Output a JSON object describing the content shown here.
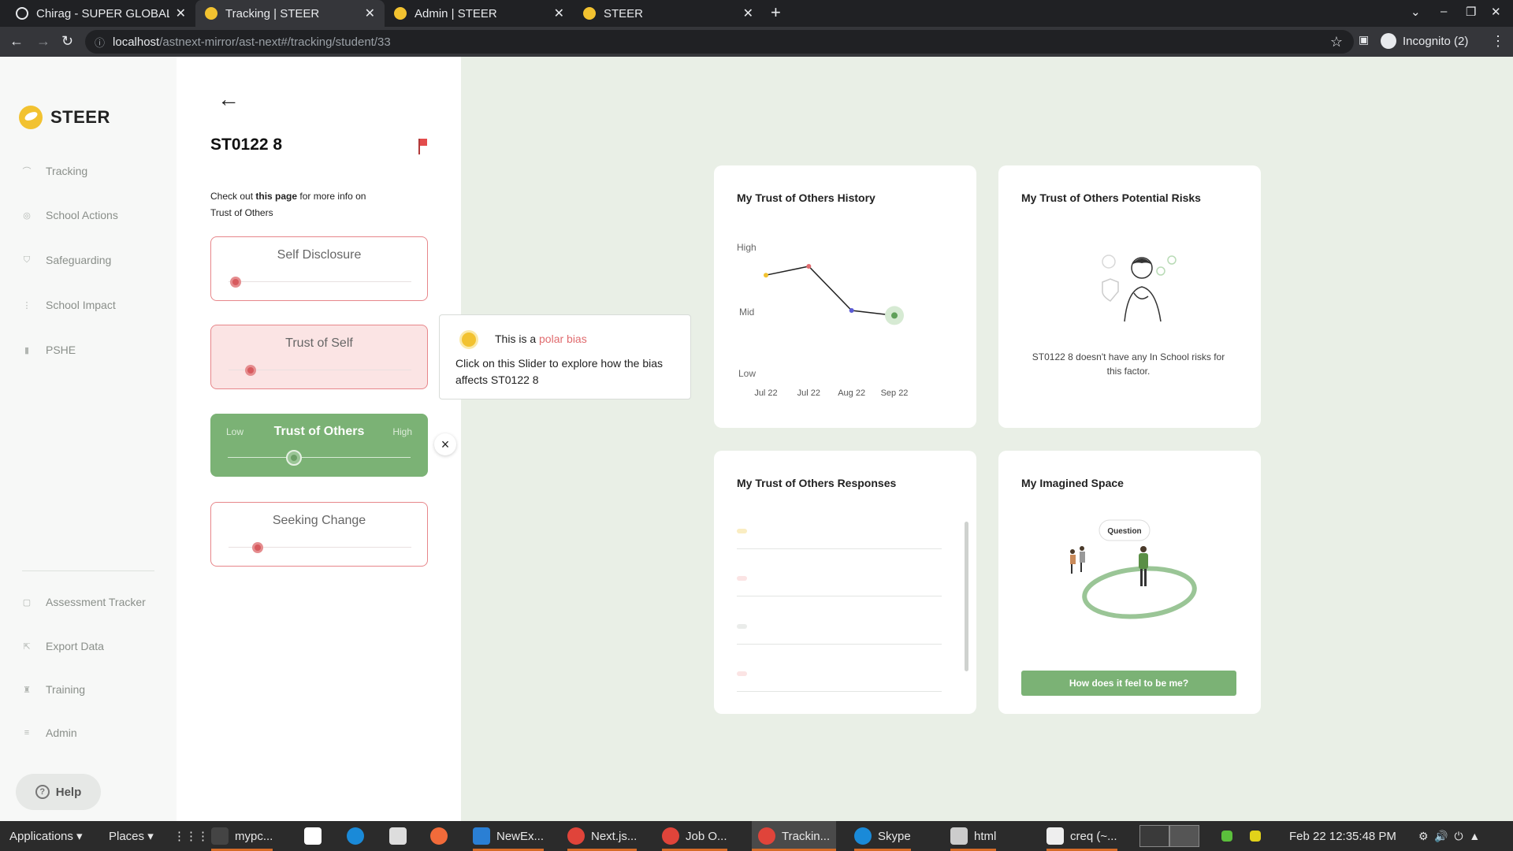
{
  "browser": {
    "tabs": [
      {
        "title": "Chirag - SUPER GLOBAL A",
        "active": false
      },
      {
        "title": "Tracking | STEER",
        "active": true
      },
      {
        "title": "Admin | STEER",
        "active": false
      },
      {
        "title": "STEER",
        "active": false
      }
    ],
    "new_tab": "+",
    "url_host": "localhost",
    "url_path": "/astnext-mirror/ast-next#/tracking/student/33",
    "profile": "Incognito (2)"
  },
  "sidebar": {
    "logo_text": "STEER",
    "items": [
      {
        "label": "Tracking",
        "icon": "line-icon"
      },
      {
        "label": "School Actions",
        "icon": "target-icon"
      },
      {
        "label": "Safeguarding",
        "icon": "shield-icon"
      },
      {
        "label": "School Impact",
        "icon": "bars-icon"
      },
      {
        "label": "PSHE",
        "icon": "book-icon"
      }
    ],
    "bottom_items": [
      {
        "label": "Assessment Tracker",
        "icon": "clipboard-icon"
      },
      {
        "label": "Export Data",
        "icon": "export-icon"
      },
      {
        "label": "Training",
        "icon": "trophy-icon"
      },
      {
        "label": "Admin",
        "icon": "menu-icon"
      }
    ],
    "help_label": "Help"
  },
  "panel": {
    "back_arrow": "←",
    "student_id": "ST0122 8",
    "info_prefix": "Check out ",
    "info_link": "this page",
    "info_suffix": " for more info on",
    "info_topic": "Trust of Others",
    "biases": [
      {
        "name": "Self Disclosure",
        "value": 0.04
      },
      {
        "name": "Trust of Self",
        "value": 0.12
      },
      {
        "name": "Trust of Others",
        "value": 0.36,
        "low": "Low",
        "high": "High"
      },
      {
        "name": "Seeking Change",
        "value": 0.16
      }
    ],
    "close": "×"
  },
  "tooltip": {
    "prefix": "This is a ",
    "highlight": "polar bias",
    "body": "Click on this Slider to explore how the bias affects ST0122 8"
  },
  "cards": {
    "history_title": "My Trust of Others History",
    "risks_title": "My Trust of Others Potential Risks",
    "risks_text": "ST0122 8 doesn't have any  In School risks for this factor.",
    "responses_title": "My Trust of Others Responses",
    "space_title": "My Imagined Space",
    "space_bubble": "Question",
    "space_button": "How does it feel to be me?"
  },
  "chart_data": {
    "type": "line",
    "title": "My Trust of Others History",
    "y_ticks": [
      "Low",
      "Mid",
      "High"
    ],
    "x": [
      "Jul 22",
      "Jul 22",
      "Aug 22",
      "Sep 22"
    ],
    "values": [
      0.78,
      0.85,
      0.5,
      0.46
    ],
    "ylim": [
      0,
      1
    ],
    "point_colors": [
      "#f2c230",
      "#e06b6e",
      "#5b5bd6",
      "#5fa05a"
    ]
  },
  "colors": {
    "accent_green": "#7bb275",
    "alert_red": "#e06b6e",
    "brand_yellow": "#f2c230"
  },
  "taskbar": {
    "items": [
      {
        "label": "Applications ▾"
      },
      {
        "label": "Places ▾"
      },
      {
        "label": "mypc..."
      },
      {
        "label": "NewEx..."
      },
      {
        "label": "Next.js..."
      },
      {
        "label": "Job O..."
      },
      {
        "label": "Trackin..."
      },
      {
        "label": "Skype"
      },
      {
        "label": "html"
      },
      {
        "label": "creq (~..."
      }
    ],
    "clock": "Feb 22  12:35:48 PM"
  }
}
